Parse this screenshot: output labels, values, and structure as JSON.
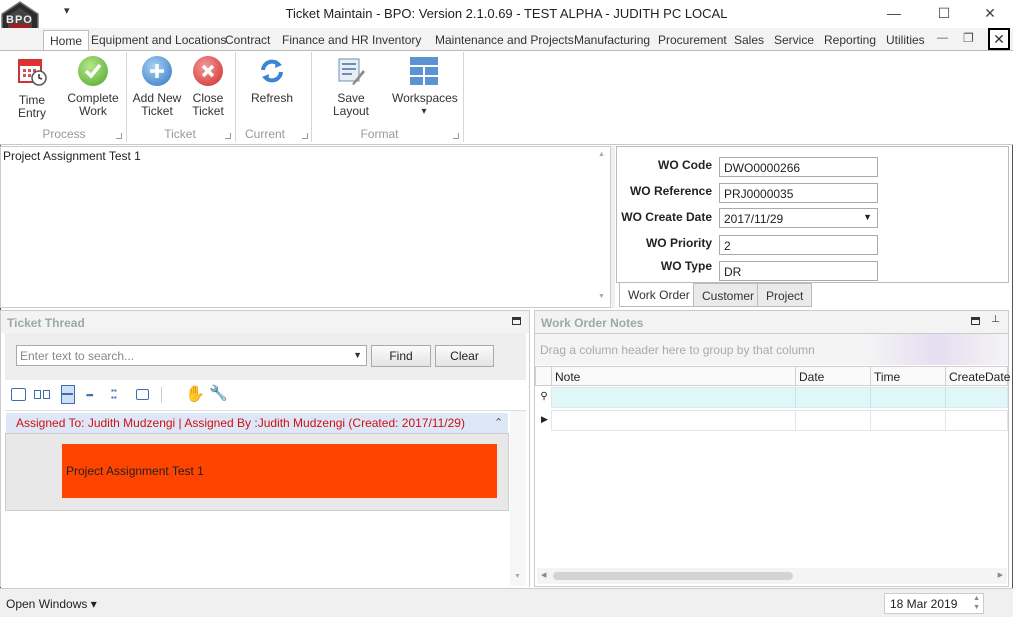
{
  "window": {
    "title": "Ticket Maintain - BPO: Version 2.1.0.69 - TEST ALPHA - JUDITH PC LOCAL",
    "minimize": "—",
    "maximize": "☐",
    "close": "✕"
  },
  "logo_text": "BPO",
  "qat_glyph": "▾",
  "ribbon_tabs": [
    {
      "label": "Home",
      "active": true
    },
    {
      "label": "Equipment and Locations"
    },
    {
      "label": "Contract"
    },
    {
      "label": "Finance and HR"
    },
    {
      "label": "Inventory"
    },
    {
      "label": "Maintenance and Projects"
    },
    {
      "label": "Manufacturing"
    },
    {
      "label": "Procurement"
    },
    {
      "label": "Sales"
    },
    {
      "label": "Service"
    },
    {
      "label": "Reporting"
    },
    {
      "label": "Utilities"
    }
  ],
  "tab_controls": {
    "minimize": "—",
    "restore": "❐",
    "close": "✕"
  },
  "ribbon": {
    "buttons": {
      "time_entry": {
        "line1": "Time Entry",
        "line2": "",
        "icon": "calendar-clock-icon"
      },
      "complete_work": {
        "line1": "Complete",
        "line2": "Work",
        "icon": "check-circle-icon"
      },
      "add_new_ticket": {
        "line1": "Add New",
        "line2": "Ticket",
        "icon": "plus-circle-icon"
      },
      "close_ticket": {
        "line1": "Close",
        "line2": "Ticket",
        "icon": "x-circle-icon"
      },
      "refresh": {
        "line1": "Refresh",
        "line2": "",
        "icon": "refresh-icon"
      },
      "save_layout": {
        "line1": "Save Layout",
        "line2": "",
        "icon": "save-layout-icon"
      },
      "workspaces": {
        "line1": "Workspaces",
        "line2": "▾",
        "icon": "workspaces-icon"
      }
    },
    "groups": {
      "process": "Process",
      "ticket": "Ticket",
      "current": "Current",
      "format": "Format"
    }
  },
  "description": {
    "text": "Project Assignment Test 1"
  },
  "work_order": {
    "code_label": "WO Code",
    "code": "DWO0000266",
    "reference_label": "WO Reference",
    "reference": "PRJ0000035",
    "create_date_label": "WO Create Date",
    "create_date": "2017/11/29",
    "priority_label": "WO Priority",
    "priority": "2",
    "type_label": "WO Type",
    "type": "DR",
    "tabs": [
      "Work Order",
      "Customer",
      "Project"
    ]
  },
  "ticket_thread": {
    "header": "Ticket Thread",
    "search_placeholder": "Enter text to search...",
    "find": "Find",
    "clear": "Clear",
    "assignment": "Assigned To: Judith Mudzengi | Assigned By :Judith Mudzengi (Created: 2017/11/29)",
    "message": "Project Assignment Test 1",
    "message_color": "#ff4400"
  },
  "work_order_notes": {
    "header": "Work Order Notes",
    "group_hint": "Drag a column header here to group by that column",
    "columns": [
      "Note",
      "Date",
      "Time",
      "CreateDate"
    ]
  },
  "status": {
    "open_windows": "Open Windows ▾",
    "date": "18 Mar 2019"
  }
}
